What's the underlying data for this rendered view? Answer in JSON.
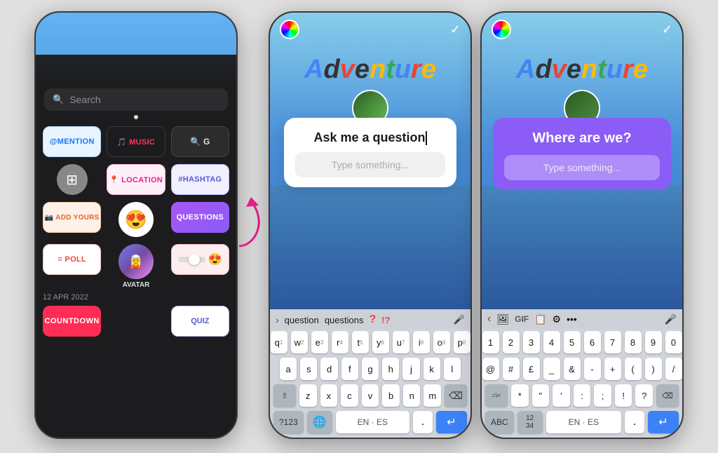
{
  "phones": {
    "phone1": {
      "search_placeholder": "Search",
      "stickers": [
        {
          "label": "@MENTION",
          "type": "mention"
        },
        {
          "label": "♫ MUSIC",
          "type": "music"
        },
        {
          "label": "🔍 G",
          "type": "gif"
        },
        {
          "label": "LOCATION",
          "type": "location"
        },
        {
          "label": "#HASHTAG",
          "type": "hashtag"
        },
        {
          "label": "ADD YOURS",
          "type": "addyours"
        },
        {
          "label": "😍",
          "type": "emoji"
        },
        {
          "label": "QUESTIONS",
          "type": "questions"
        },
        {
          "label": "≡ POLL",
          "type": "poll"
        },
        {
          "label": "",
          "type": "avatar"
        },
        {
          "label": "",
          "type": "slider"
        }
      ],
      "countdown_label": "COUNTDOWN",
      "quiz_label": "QUIZ",
      "date_label": "12 APR 2022"
    },
    "phone2": {
      "adventure_text": "Adventure",
      "question_title": "Ask me a question",
      "question_placeholder": "Type something...",
      "keyboard": {
        "suggestions": [
          "question",
          "questions",
          "?",
          "!?"
        ],
        "rows": [
          [
            "q",
            "w",
            "e",
            "r",
            "t",
            "y",
            "u",
            "i",
            "o",
            "p"
          ],
          [
            "a",
            "s",
            "d",
            "f",
            "g",
            "h",
            "j",
            "k",
            "l"
          ],
          [
            "z",
            "x",
            "c",
            "v",
            "b",
            "n",
            "m"
          ]
        ],
        "bottom": [
          "?123",
          "EN·ES",
          ".",
          "↵"
        ]
      }
    },
    "phone3": {
      "adventure_text": "Adventure",
      "question_title": "Where are we?",
      "question_placeholder": "Type something...",
      "keyboard": {
        "rows": [
          [
            "1",
            "2",
            "3",
            "4",
            "5",
            "6",
            "7",
            "8",
            "9",
            "0"
          ],
          [
            "@",
            "#",
            "£",
            "_",
            "&",
            "-",
            "+",
            "(",
            ")",
            "/"
          ],
          [
            "=\\<",
            "*",
            "\"",
            "'",
            ":",
            ";",
            "!",
            "?"
          ],
          [
            "ABC",
            "12/34",
            "EN·ES",
            ".",
            "↵"
          ]
        ]
      }
    }
  }
}
